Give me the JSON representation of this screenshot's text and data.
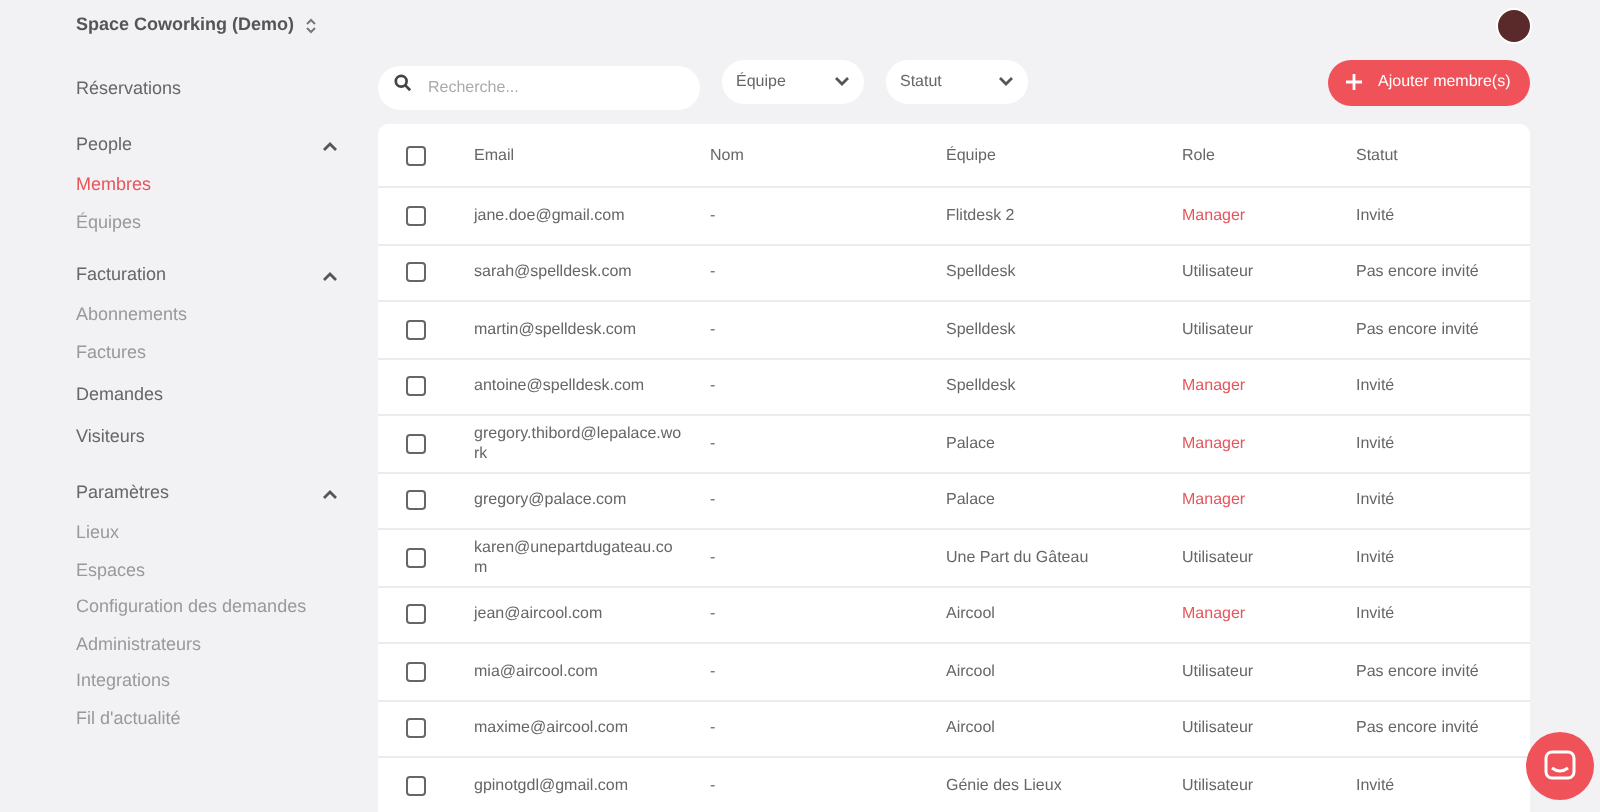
{
  "workspace": {
    "name": "Space Coworking (Demo)"
  },
  "nav": [
    {
      "kind": "link",
      "label": "Réservations",
      "selected": false
    },
    {
      "kind": "group",
      "label": "People",
      "expanded": true,
      "children": [
        {
          "label": "Membres",
          "selected": true
        },
        {
          "label": "Équipes",
          "selected": false
        }
      ]
    },
    {
      "kind": "group",
      "label": "Facturation",
      "expanded": true,
      "children": [
        {
          "label": "Abonnements",
          "selected": false
        },
        {
          "label": "Factures",
          "selected": false
        }
      ]
    },
    {
      "kind": "link",
      "label": "Demandes",
      "selected": false
    },
    {
      "kind": "link",
      "label": "Visiteurs",
      "selected": false
    },
    {
      "kind": "group",
      "label": "Paramètres",
      "expanded": true,
      "children": [
        {
          "label": "Lieux",
          "selected": false
        },
        {
          "label": "Espaces",
          "selected": false
        },
        {
          "label": "Configuration des demandes",
          "selected": false
        },
        {
          "label": "Administrateurs",
          "selected": false
        },
        {
          "label": "Integrations",
          "selected": false
        },
        {
          "label": "Fil d'actualité",
          "selected": false
        }
      ]
    }
  ],
  "search": {
    "placeholder": "Recherche..."
  },
  "filters": [
    {
      "label": "Équipe"
    },
    {
      "label": "Statut"
    }
  ],
  "add_button": {
    "label": "Ajouter membre(s)"
  },
  "table": {
    "all_checked": false,
    "columns": [
      "Email",
      "Nom",
      "Équipe",
      "Role",
      "Statut"
    ],
    "rows": [
      {
        "checked": false,
        "email": "jane.doe@gmail.com",
        "name": "-",
        "team": "Flitdesk 2",
        "role": "Manager",
        "highlighted": true,
        "status": "Invité"
      },
      {
        "checked": false,
        "email": "sarah@spelldesk.com",
        "name": "-",
        "team": "Spelldesk",
        "role": "Utilisateur",
        "highlighted": false,
        "status": "Pas encore invité"
      },
      {
        "checked": false,
        "email": "martin@spelldesk.com",
        "name": "-",
        "team": "Spelldesk",
        "role": "Utilisateur",
        "highlighted": false,
        "status": "Pas encore invité"
      },
      {
        "checked": false,
        "email": "antoine@spelldesk.com",
        "name": "-",
        "team": "Spelldesk",
        "role": "Manager",
        "highlighted": true,
        "status": "Invité"
      },
      {
        "checked": false,
        "email": "gregory.thibord@lepalace.work",
        "name": "-",
        "team": "Palace",
        "role": "Manager",
        "highlighted": true,
        "status": "Invité"
      },
      {
        "checked": false,
        "email": "gregory@palace.com",
        "name": "-",
        "team": "Palace",
        "role": "Manager",
        "highlighted": true,
        "status": "Invité"
      },
      {
        "checked": false,
        "email": "karen@unepartdugateau.com",
        "name": "-",
        "team": "Une Part du Gâteau",
        "role": "Utilisateur",
        "highlighted": false,
        "status": "Invité"
      },
      {
        "checked": false,
        "email": "jean@aircool.com",
        "name": "-",
        "team": "Aircool",
        "role": "Manager",
        "highlighted": true,
        "status": "Invité"
      },
      {
        "checked": false,
        "email": "mia@aircool.com",
        "name": "-",
        "team": "Aircool",
        "role": "Utilisateur",
        "highlighted": false,
        "status": "Pas encore invité"
      },
      {
        "checked": false,
        "email": "maxime@aircool.com",
        "name": "-",
        "team": "Aircool",
        "role": "Utilisateur",
        "highlighted": false,
        "status": "Pas encore invité"
      },
      {
        "checked": false,
        "email": "gpinotgdl@gmail.com",
        "name": "-",
        "team": "Génie des Lieux",
        "role": "Utilisateur",
        "highlighted": false,
        "status": "Invité"
      }
    ]
  }
}
